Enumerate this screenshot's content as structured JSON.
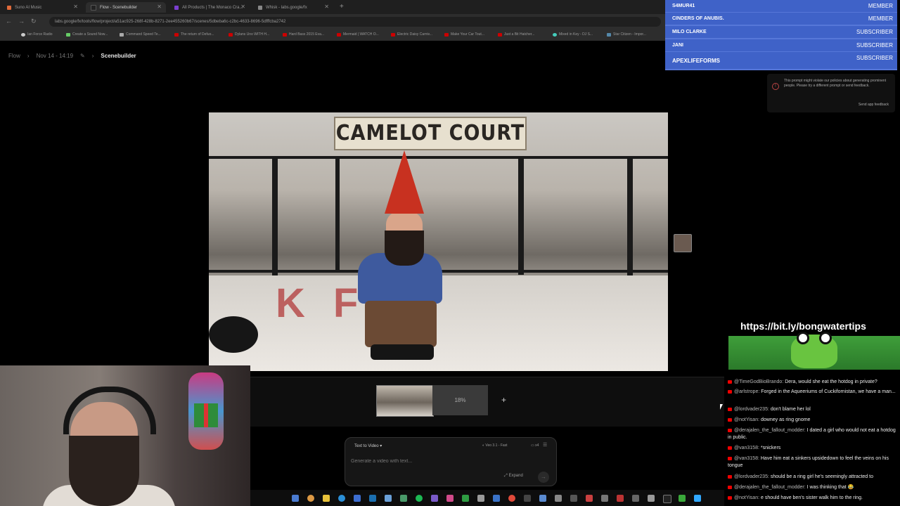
{
  "browser": {
    "tabs": [
      {
        "label": "Suno AI Music",
        "color": "#e06a3a",
        "active": false
      },
      {
        "label": "Flow - Scenebuilder",
        "color": "#222222",
        "active": true
      },
      {
        "label": "All Products | The Monaco Cra...",
        "color": "#7b3fd0",
        "active": false
      },
      {
        "label": "Whisk - labs.google/fx",
        "color": "#888888",
        "active": false
      }
    ],
    "new_tab": "+",
    "url": "labs.google/fx/tools/flow/project/a51ac925-268f-428b-8271-2ee455260b67/scenes/5dbeba6c-c2bc-4633-8696-5dfffcba2742",
    "bookmarks": [
      "Ian Force Radio",
      "Create a Sound Now...",
      "Command Speed Te...",
      "The return of Defuo...",
      "Dylans Uno WITH H...",
      "Hard Bass 2015 Eva...",
      "Mermaid | WATCH O...",
      "Electric Daisy Carniv...",
      "Make Your Car Tout...",
      "Just a Bit Hatcher...",
      "Mixed in Key - DJ S...",
      "Star Citizen - Impor..."
    ]
  },
  "breadcrumb": {
    "root": "Flow",
    "date": "Nov 14 - 14:19",
    "current": "Scenebuilder"
  },
  "video": {
    "banner": "CAMELOT COURT",
    "floor_text": "KFC"
  },
  "timeline": {
    "progress_label": "18%",
    "progress": 0.18,
    "add_label": "+"
  },
  "prompt_box": {
    "mode": "Text to Video",
    "model": "Veo 3.1 - Fast",
    "count": "x4",
    "placeholder": "Generate a video with text...",
    "expand": "Expand",
    "send": "→"
  },
  "overlay": {
    "members": [
      {
        "name": "S4MUR41",
        "tier": "MEMBER"
      },
      {
        "name": "CINDERS OF ANUBIS.",
        "tier": "MEMBER"
      },
      {
        "name": "MILO CLARKE",
        "tier": "SUBSCRIBER"
      },
      {
        "name": "JANI",
        "tier": "SUBSCRIBER"
      },
      {
        "name": "APEXLIFEFORMS",
        "tier": "SUBSCRIBER"
      }
    ],
    "warning": {
      "text": "This prompt might violate our policies about generating prominent people. Please try a different prompt or send feedback.",
      "feedback": "Send app feedback"
    },
    "link": "https://bit.ly/bongwatertips"
  },
  "chat": [
    {
      "user": "@TimeGodBioBrando:",
      "text": "Dera, would she eat the hotdog in private?"
    },
    {
      "user": "@arlstrope:",
      "text": "Forged in the Aqueeriums of Cuckifornistan, we have a man..."
    },
    {
      "user": "@lordvader235:",
      "text": "don't blame her lol"
    },
    {
      "user": "@notYisan:",
      "text": "downey as ring gnome"
    },
    {
      "user": "@derajalen_the_fallout_modder:",
      "text": "I dated a girl who would not eat a hotdog in public."
    },
    {
      "user": "@van3158:",
      "text": "*snickers"
    },
    {
      "user": "@van3158:",
      "text": "Have him eat a sinkers upsidedown to feel the veins on his tongue"
    },
    {
      "user": "@lordvader235:",
      "text": "should be a ring girl he's seemingly attracted to"
    },
    {
      "user": "@derajalen_the_fallout_modder:",
      "text": "I was thinking that 😂"
    },
    {
      "user": "@notYisan:",
      "text": "e should have ben's sister walk him to the ring."
    }
  ]
}
